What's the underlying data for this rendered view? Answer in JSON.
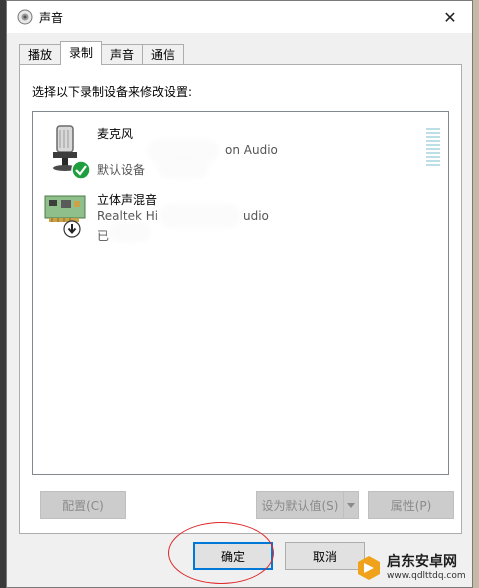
{
  "window": {
    "title": "声音",
    "icon": "speaker-icon"
  },
  "tabs": [
    {
      "label": "播放",
      "active": false
    },
    {
      "label": "录制",
      "active": true
    },
    {
      "label": "声音",
      "active": false
    },
    {
      "label": "通信",
      "active": false
    }
  ],
  "recording": {
    "instruction": "选择以下录制设备来修改设置:",
    "devices": [
      {
        "name": "麦克风",
        "description": "on Audio",
        "status": "默认设备",
        "icon": "microphone-icon",
        "badge": "default-check-icon"
      },
      {
        "name": "立体声混音",
        "description": "Realtek Hi",
        "description_tail": "udio",
        "status": "已",
        "icon": "sound-card-icon",
        "badge": "down-arrow-icon"
      }
    ]
  },
  "buttons": {
    "configure": "配置(C)",
    "set_default": "设为默认值(S)",
    "properties": "属性(P)",
    "ok": "确定",
    "cancel": "取消"
  },
  "watermark": {
    "name": "启东安卓网",
    "url": "www.qdlttdq.com"
  },
  "colors": {
    "accent": "#0078d7",
    "annotation": "#e0262a",
    "check_green": "#1e9e3e"
  }
}
